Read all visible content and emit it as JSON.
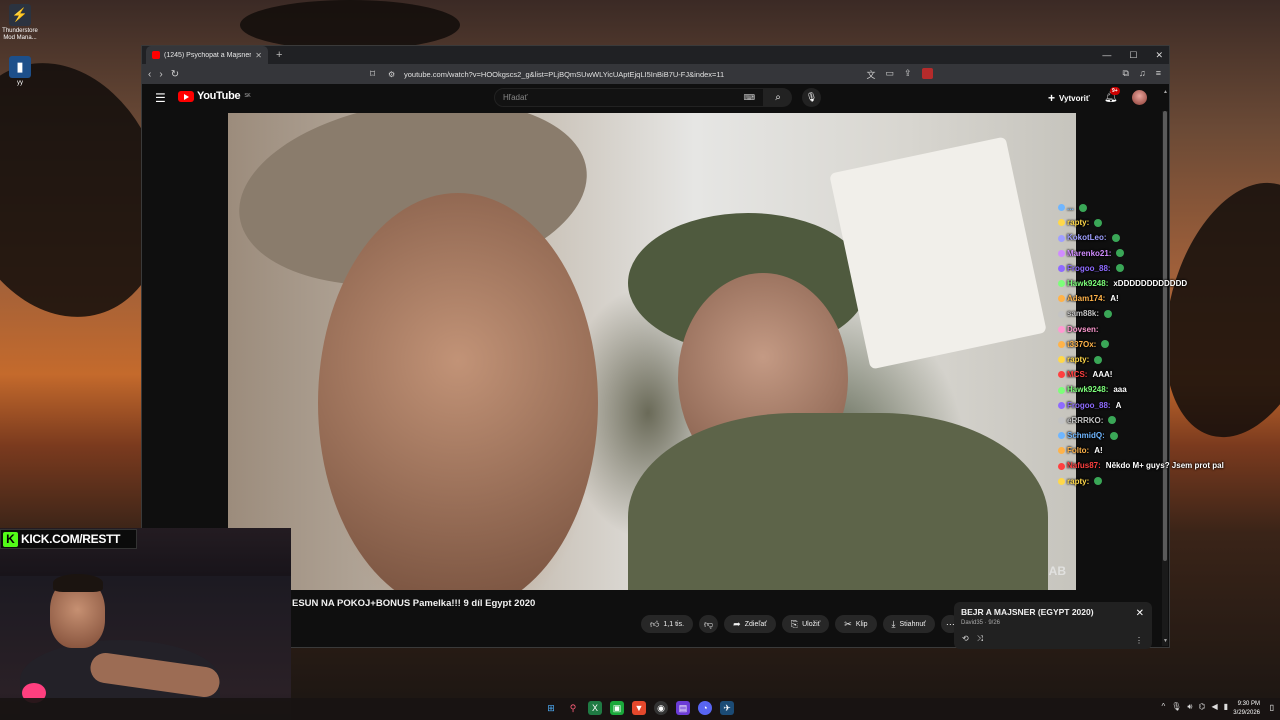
{
  "desktop": {
    "icons": [
      {
        "label": "Thunderstore Mod Mana...",
        "icon": "thunderstore-icon"
      },
      {
        "label": "yy",
        "icon": "app-icon"
      }
    ]
  },
  "browser": {
    "tab_title": "(1245) Psychopat a Majsner v...",
    "url": "youtube.com/watch?v=HOOkgscs2_g&list=PLjBQmSUwWLYicUAptEjqLI5InBiB7U-FJ&index=11"
  },
  "youtube": {
    "logo": "YouTube",
    "region": "SK",
    "search_placeholder": "Hľadať",
    "create_label": "Vytvoriť",
    "notification_count": "9+",
    "video_title": "ESUN NA POKOJ+BONUS Pamelka!!! 9 díl Egypt 2020",
    "watermark": "AB",
    "actions": {
      "like": "1,1 tis.",
      "share": "Zdieľať",
      "save": "Uložiť",
      "clip": "Klip",
      "download": "Stiahnuť"
    },
    "playlist": {
      "title": "BEJR A MAJSNER (EGYPT 2020)",
      "subtitle": "David35 · 9/26"
    }
  },
  "stream": {
    "kick_url": "KICK.COM/RESTT",
    "chat": [
      {
        "user": "...",
        "color": "#6fb6ff",
        "msg": "",
        "emote": true
      },
      {
        "user": "rapty:",
        "color": "#ffd84a",
        "msg": "",
        "emote": true
      },
      {
        "user": "KokotLeo:",
        "color": "#a0a0ff",
        "msg": "",
        "emote": true
      },
      {
        "user": "Marenko21:",
        "color": "#d18cff",
        "msg": "",
        "emote": true
      },
      {
        "user": "Frogoo_88:",
        "color": "#8f6bff",
        "msg": "",
        "emote": true
      },
      {
        "user": "Hawk9248:",
        "color": "#7dff7a",
        "msg": "xDDDDDDDDDDDD",
        "emote": false
      },
      {
        "user": "Adam174:",
        "color": "#ffb34a",
        "msg": "A!",
        "emote": false
      },
      {
        "user": "sam88k:",
        "color": "#c4c4c4",
        "msg": "",
        "emote": true
      },
      {
        "user": "Dovsen:",
        "color": "#ff9ad1",
        "msg": "",
        "emote": false
      },
      {
        "user": "t337Ox:",
        "color": "#ffb34a",
        "msg": "",
        "emote": true
      },
      {
        "user": "rapty:",
        "color": "#ffd84a",
        "msg": "",
        "emote": true
      },
      {
        "user": "MCS:",
        "color": "#ff4040",
        "msg": "AAA!",
        "emote": false
      },
      {
        "user": "Hawk9248:",
        "color": "#7dff7a",
        "msg": "aaa",
        "emote": false
      },
      {
        "user": "Frogoo_88:",
        "color": "#8f6bff",
        "msg": "A",
        "emote": false
      },
      {
        "user": "eRRRKO:",
        "color": "#c4c4c4",
        "msg": "",
        "emote": true
      },
      {
        "user": "SchmidQ:",
        "color": "#6fb6ff",
        "msg": "",
        "emote": true
      },
      {
        "user": "Folto:",
        "color": "#ffb34a",
        "msg": "A!",
        "emote": false
      },
      {
        "user": "Nafus87:",
        "color": "#ff4040",
        "msg": "Někdo M+ guys? Jsem prot pal",
        "emote": false
      },
      {
        "user": "rapty:",
        "color": "#ffd84a",
        "msg": "",
        "emote": true
      }
    ]
  },
  "taskbar": {
    "time": "9:30 PM",
    "date": "3/29/2026"
  }
}
